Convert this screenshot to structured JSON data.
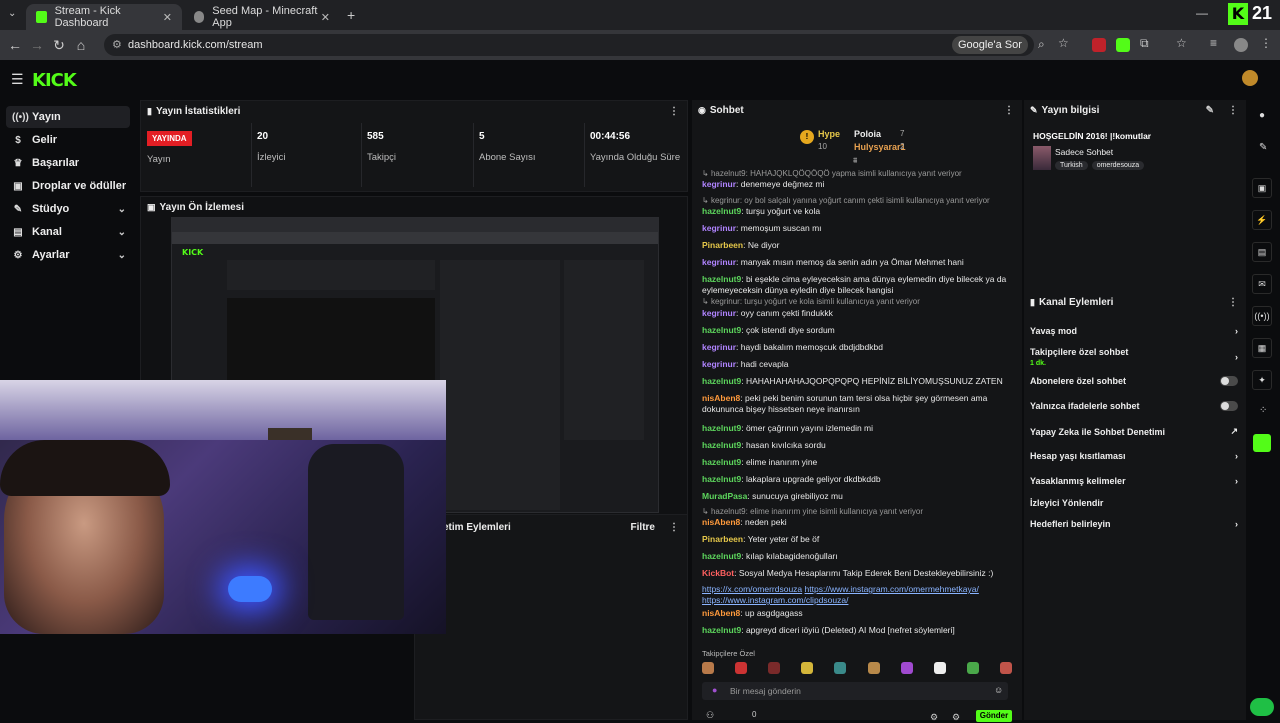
{
  "browser": {
    "tabs": [
      {
        "label": "Stream - Kick Dashboard",
        "active": true
      },
      {
        "label": "Seed Map - Minecraft App",
        "active": false
      }
    ],
    "url": "dashboard.kick.com/stream",
    "google_btn": "Google'a Sor",
    "corner_counter": "21"
  },
  "brand": {
    "logo": "KICK",
    "accent": "#53fc18"
  },
  "sidebar": {
    "items": [
      {
        "label": "Yayın",
        "icon": "broadcast-icon",
        "active": true
      },
      {
        "label": "Gelir",
        "icon": "dollar-icon"
      },
      {
        "label": "Başarılar",
        "icon": "trophy-icon"
      },
      {
        "label": "Droplar ve ödüller",
        "icon": "gift-icon"
      },
      {
        "label": "Stüdyo",
        "icon": "pen-icon",
        "chevron": true
      },
      {
        "label": "Kanal",
        "icon": "channel-icon",
        "chevron": true
      },
      {
        "label": "Ayarlar",
        "icon": "gear-icon",
        "chevron": true
      }
    ]
  },
  "stats": {
    "title": "Yayın İstatistikleri",
    "live_badge": "YAYINDA",
    "items": [
      {
        "value": "",
        "label": "Yayın"
      },
      {
        "value": "20",
        "label": "İzleyici"
      },
      {
        "value": "585",
        "label": "Takipçi"
      },
      {
        "value": "5",
        "label": "Abone Sayısı"
      },
      {
        "value": "00:44:56",
        "label": "Yayında Olduğu Süre"
      }
    ]
  },
  "preview": {
    "title": "Yayın Ön İzlemesi"
  },
  "actions": {
    "title": "etim Eylemleri",
    "filter": "Filtre"
  },
  "chat": {
    "title": "Sohbet",
    "hype": {
      "label": "Hype",
      "level": "10",
      "user1": "Poloia",
      "user1_count": "7",
      "user2": "Hulysyarar1",
      "user2_count": "2"
    },
    "messages": [
      {
        "reply": "hazelnut9: HAHAJQKLQÖQÖQÖ yapma isimli kullanıcıya yanıt veriyor"
      },
      {
        "user": "kegrinur",
        "color": "cpurp",
        "text": "denemeye değmez mi"
      },
      {
        "reply": "kegrinur: oy bol salçalı yanına yoğurt canım çekti isimli kullanıcıya yanıt veriyor"
      },
      {
        "user": "hazelnut9",
        "color": "cgreen",
        "text": "turşu yoğurt ve kola"
      },
      {
        "user": "kegrinur",
        "color": "cpurp",
        "text": "memoşum suscan mı"
      },
      {
        "user": "Pinarbeen",
        "color": "cyellow",
        "text": "Ne diyor"
      },
      {
        "user": "kegrinur",
        "color": "cpurp",
        "text": "manyak mısın memoş da senin adın ya Ömar Mehmet hani"
      },
      {
        "user": "hazelnut9",
        "color": "cgreen",
        "text": "bi eşekle cima eyleyeceksin ama dünya eylemedin diye bilecek ya da eylemeyeceksin dünya eyledin diye bilecek hangisi"
      },
      {
        "reply": "kegrinur: turşu yoğurt ve kola isimli kullanıcıya yanıt veriyor"
      },
      {
        "user": "kegrinur",
        "color": "cpurp",
        "text": "oyy canım çekti findukkk"
      },
      {
        "user": "hazelnut9",
        "color": "cgreen",
        "text": "çok istendi diye sordum"
      },
      {
        "user": "kegrinur",
        "color": "cpurp",
        "text": "haydi bakalım memoşcuk dbdjdbdkbd"
      },
      {
        "user": "kegrinur",
        "color": "cpurp",
        "text": "hadi cevapla"
      },
      {
        "user": "hazelnut9",
        "color": "cgreen",
        "text": "HAHAHAHAHAJQOPQPQPQ HEPİNİZ BİLİYOMUŞSUNUZ ZATEN"
      },
      {
        "user": "nisAben8",
        "color": "corange",
        "text": "peki peki benim sorunun tam tersi olsa hiçbir şey görmesen ama dokununca bişey hissetsen neye inanırsın"
      },
      {
        "user": "hazelnut9",
        "color": "cgreen",
        "text": "ömer çağrının yayını izlemedin mi"
      },
      {
        "user": "hazelnut9",
        "color": "cgreen",
        "text": "hasan kıvılcıka sordu"
      },
      {
        "user": "hazelnut9",
        "color": "cgreen",
        "text": "elime inanırım yine"
      },
      {
        "user": "hazelnut9",
        "color": "cgreen",
        "text": "lakaplara upgrade geliyor dkdbkddb"
      },
      {
        "user": "MuradPasa",
        "color": "cgreen",
        "text": "sunucuya girebiliyoz mu"
      },
      {
        "reply": "hazelnut9: elime inanırım yine isimli kullanıcıya yanıt veriyor"
      },
      {
        "user": "nisAben8",
        "color": "corange",
        "text": "neden peki"
      },
      {
        "user": "Pinarbeen",
        "color": "cyellow",
        "text": "Yeter yeter öf be öf"
      },
      {
        "user": "hazelnut9",
        "color": "cgreen",
        "text": "kılap kılabagidenoğulları"
      },
      {
        "user": "KickBot",
        "color": "cred",
        "text": "Sosyal Medya Hesaplarımı Takip Ederek Beni Destekleyebilirsiniz :)"
      },
      {
        "user": "nisAben8",
        "color": "corange",
        "text": "up asgdgagass"
      },
      {
        "user": "hazelnut9",
        "color": "cgreen",
        "text": "apgreyd diceri iöyiü (Deleted) AI Mod [nefret söylemleri]"
      }
    ],
    "links": [
      "https://x.com/omerrdsouza",
      "https://www.instagram.com/omermehmetkaya/",
      "https://www.instagram.com/clipdsouza/"
    ],
    "followers_label": "Takipçilere Özel",
    "input_placeholder": "Bir mesaj gönderin",
    "send_label": "Gönder",
    "count": "0"
  },
  "info": {
    "title": "Yayın bilgisi",
    "stream_title": "HOŞGELDİN 2016! |!komutlar",
    "category": "Sadece Sohbet",
    "tags": [
      "Turkish",
      "omerdesouza"
    ]
  },
  "kanal": {
    "title": "Kanal Eylemleri",
    "rows": [
      {
        "label": "Yavaş mod",
        "ctrl": "chevron"
      },
      {
        "label": "Takipçilere özel sohbet",
        "sub": "1 dk.",
        "ctrl": "chevron"
      },
      {
        "label": "Abonelere özel sohbet",
        "ctrl": "toggle"
      },
      {
        "label": "Yalnızca ifadelerle sohbet",
        "ctrl": "toggle"
      },
      {
        "label": "Yapay Zeka ile Sohbet Denetimi",
        "ctrl": "external"
      },
      {
        "label": "Hesap yaşı kısıtlaması",
        "ctrl": "chevron"
      },
      {
        "label": "Yasaklanmış kelimeler",
        "ctrl": "chevron"
      },
      {
        "label": "İzleyici Yönlendir",
        "ctrl": ""
      },
      {
        "label": "Hedefleri belirleyin",
        "ctrl": "chevron"
      }
    ]
  }
}
